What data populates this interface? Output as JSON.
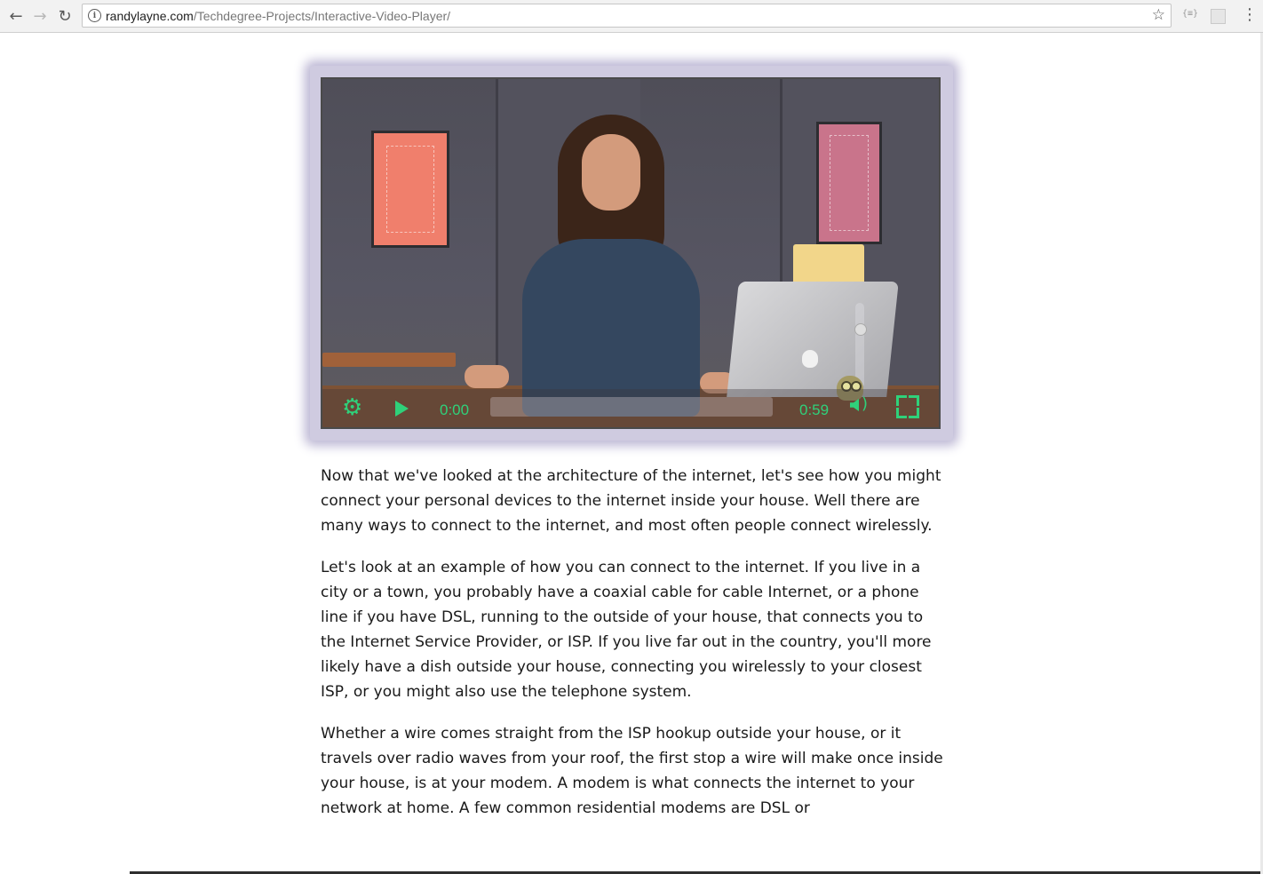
{
  "browser": {
    "url_domain": "randylayne.com",
    "url_path": "/Techdegree-Projects/Interactive-Video-Player/",
    "back_icon": "←",
    "forward_icon": "→",
    "reload_icon": "↻",
    "info_icon": "i",
    "bookmark_icon": "☆",
    "extension_label": "{≡}",
    "menu_icon": "⋮"
  },
  "player": {
    "current_time": "0:00",
    "duration": "0:59",
    "settings_icon": "⚙",
    "volume_waves_icon": ")",
    "volume_level": 0.75,
    "progress": 0.0,
    "accent_color": "#2fd17a"
  },
  "transcript": {
    "paragraphs": [
      "Now that we've looked at the architecture of the internet, let's see how you might connect your personal devices to the internet inside your house.  Well there are many ways to connect to the internet, and  most often people connect wirelessly.",
      "Let's look at an example of how you can connect to the internet.  If you live in a city or a town, you probably have a coaxial cable for  cable Internet, or a phone line if you have DSL, running to the outside of  your house, that connects you to the Internet Service Provider, or ISP.  If you live far out in the country, you'll more likely have  a dish outside your house, connecting you wirelessly to your closest ISP, or  you might also use the telephone system.",
      "Whether a wire comes straight from the ISP hookup outside your house, or  it travels over radio waves from your roof,  the first stop a wire will make once inside your house, is at your modem.  A modem is what connects the internet to your network at home.  A few common residential modems are DSL or"
    ]
  }
}
